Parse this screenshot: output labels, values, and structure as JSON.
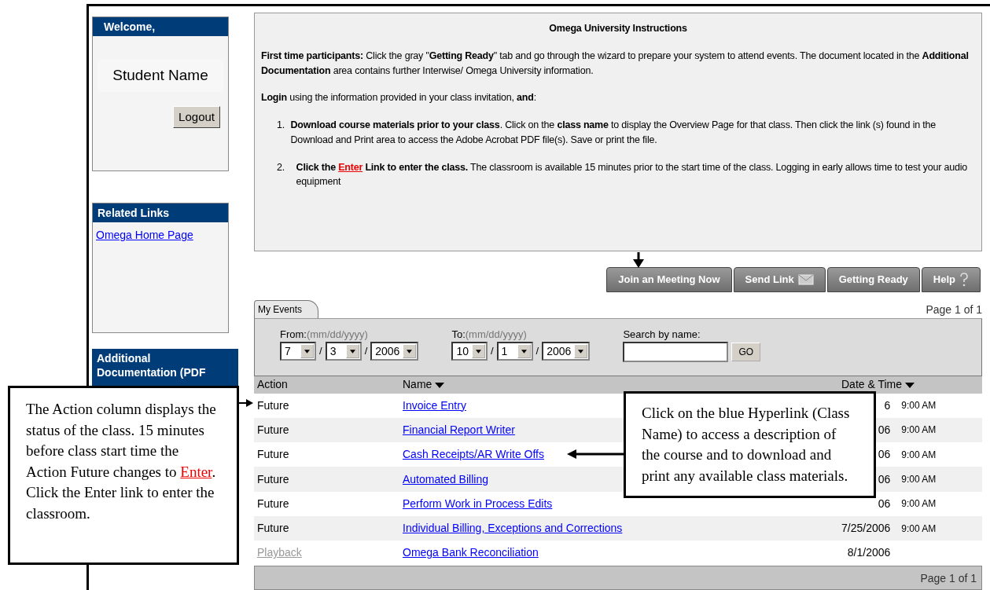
{
  "sidebar": {
    "welcome": {
      "title": "Welcome,",
      "user_name": "Student Name",
      "logout_button": "Logout"
    },
    "related_links": {
      "title": "Related Links",
      "links": [
        "Omega Home Page"
      ]
    },
    "additional_documentation": {
      "title": "Additional Documentation (PDF"
    }
  },
  "instructions": {
    "title": "Omega University Instructions",
    "paragraphs": [
      "**First time participants:** Click the gray \"**Getting Ready**\" tab and go through the wizard to prepare your system to attend events.  The document located in the **Additional Documentation** area contains further Interwise/ Omega University information.",
      "**Login** using the information provided in your class invitation, **and**:"
    ],
    "steps": [
      {
        "number": "1.",
        "parts": [
          {
            "kind": "text",
            "text": "**Download course materials prior to your class**.  Click on the **class name** to display the Overview Page for that class. Then click the link (s) found in the Download and Print area to access the Adobe Acrobat PDF file(s). Save or print the file."
          }
        ]
      },
      {
        "number": "2.",
        "parts": [
          {
            "kind": "bold",
            "text": "Click the "
          },
          {
            "kind": "link",
            "text": "Enter"
          },
          {
            "kind": "bold",
            "text": " Link to enter the class."
          },
          {
            "kind": "text",
            "text": "  The classroom is available 15 minutes prior to the start time of the class.  Logging in early allows time to test your audio equipment"
          }
        ]
      }
    ]
  },
  "action_tabs": [
    {
      "label": "Join an Meeting Now"
    },
    {
      "label": "Send Link"
    },
    {
      "label": "Getting Ready"
    },
    {
      "label": "Help"
    }
  ],
  "events": {
    "tab": "My Events",
    "page_top": "Page 1 of 1",
    "from": {
      "label": "From:",
      "hint": "(mm/dd/yyyy)",
      "month": "7",
      "day": "3",
      "year": "2006"
    },
    "to": {
      "label": "To:",
      "hint": "(mm/dd/yyyy)",
      "month": "10",
      "day": "1",
      "year": "2006"
    },
    "date_separator": "/",
    "search": {
      "label": "Search by name:",
      "button": "GO"
    },
    "columns": [
      {
        "label": "Action",
        "sortable": false
      },
      {
        "label": "Name",
        "sortable": true
      },
      {
        "label": "Date & Time",
        "sortable": true
      }
    ],
    "rows": [
      {
        "action": "Future",
        "action_enabled": true,
        "name": "Invoice Entry",
        "date": "6",
        "time": "9:00  AM"
      },
      {
        "action": "Future",
        "action_enabled": true,
        "name": "Financial Report Writer",
        "date": "06",
        "time": "9:00  AM"
      },
      {
        "action": "Future",
        "action_enabled": true,
        "name": "Cash Receipts/AR Write Offs",
        "date": "06",
        "time": "9:00  AM"
      },
      {
        "action": "Future",
        "action_enabled": true,
        "name": "Automated Billing",
        "date": "06",
        "time": "9:00  AM"
      },
      {
        "action": "Future",
        "action_enabled": true,
        "name": "Perform Work in Process Edits",
        "date": "06",
        "time": "9:00  AM"
      },
      {
        "action": "Future",
        "action_enabled": true,
        "name": "Individual Billing, Exceptions and Corrections",
        "date": "7/25/2006",
        "time": "9:00  AM"
      },
      {
        "action": "Playback",
        "action_enabled": false,
        "name": "Omega Bank Reconciliation",
        "date": "8/1/2006"
      }
    ],
    "page_bottom": "Page 1 of 1"
  },
  "callouts": [
    {
      "parts": [
        {
          "kind": "text",
          "text": "The Action column displays the status of the class.  15 minutes before class start time the Action Future changes to "
        },
        {
          "kind": "link",
          "text": "Enter"
        },
        {
          "kind": "text",
          "text": ". Click the Enter link to enter the classroom."
        }
      ]
    },
    {
      "parts": [
        {
          "kind": "text",
          "text": "Click on the blue Hyperlink (Class Name) to access a description of the course and to download and print any available class materials."
        }
      ]
    }
  ]
}
